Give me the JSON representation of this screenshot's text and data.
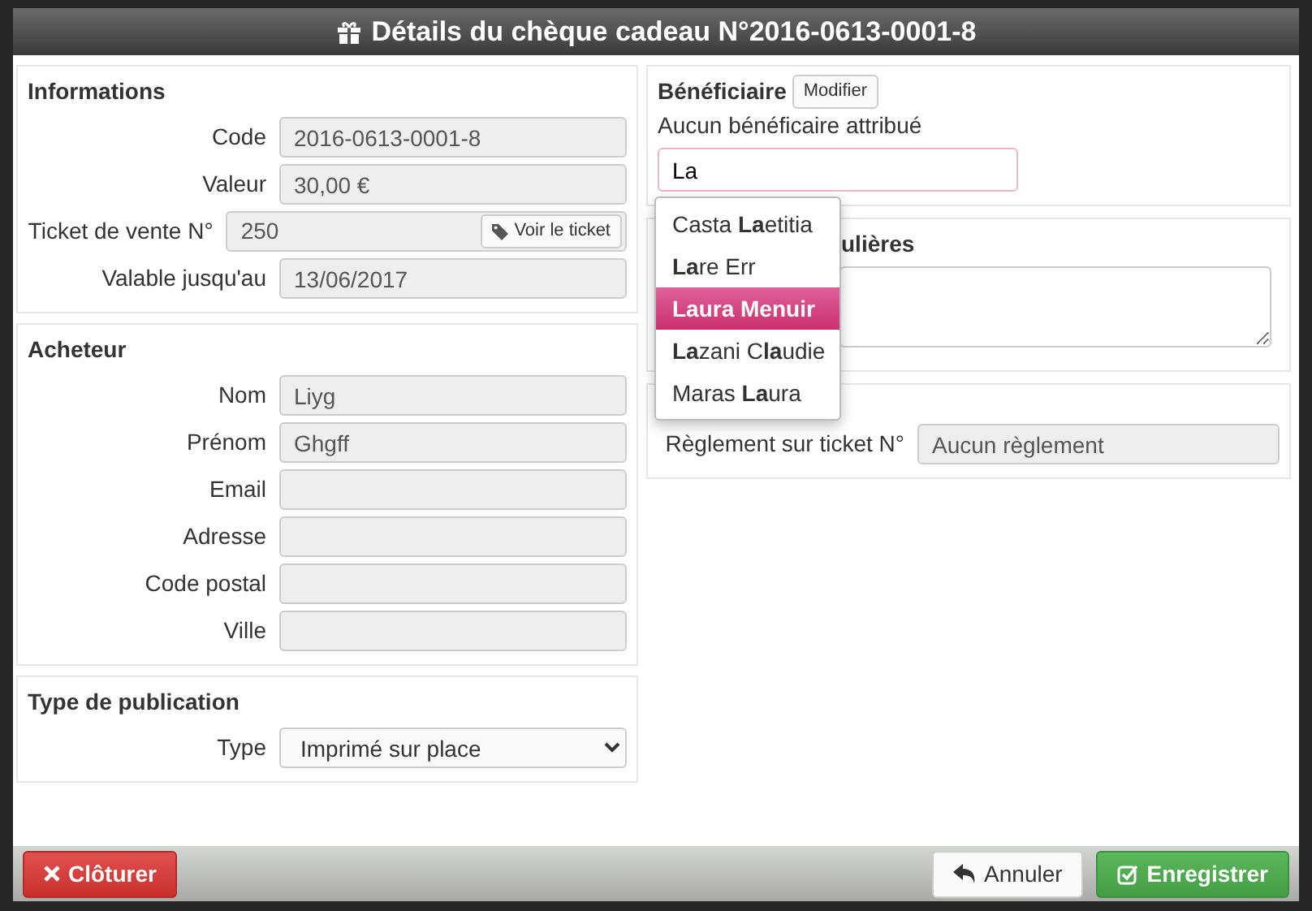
{
  "window": {
    "title": "Détails du chèque cadeau N°2016-0613-0001-8"
  },
  "informations": {
    "heading": "Informations",
    "fields": [
      {
        "label": "Code",
        "value": "2016-0613-0001-8",
        "kind": "text"
      },
      {
        "label": "Valeur",
        "value": "30,00 €",
        "kind": "text"
      },
      {
        "label": "Ticket de vente N°",
        "value": "250",
        "kind": "text",
        "button": "Voir le ticket"
      },
      {
        "label": "Valable jusqu'au",
        "value": "13/06/2017",
        "kind": "text"
      }
    ]
  },
  "acheteur": {
    "heading": "Acheteur",
    "fields": [
      {
        "label": "Nom",
        "value": "Liyg",
        "kind": "text"
      },
      {
        "label": "Prénom",
        "value": "Ghgff",
        "kind": "text"
      },
      {
        "label": "Email",
        "kind": "text"
      },
      {
        "label": "Adresse",
        "kind": "text"
      },
      {
        "label": "Code postal",
        "kind": "text"
      },
      {
        "label": "Ville",
        "kind": "text"
      }
    ]
  },
  "publication": {
    "heading": "Type de publication",
    "fields": [
      {
        "label": "Type",
        "value": "Imprimé sur place",
        "kind": "select"
      }
    ]
  },
  "beneficiaire": {
    "heading": "Bénéficiaire",
    "button": "Modifier",
    "status": "Aucun bénéficaire attribué",
    "search_value": "La"
  },
  "suggestions": [
    {
      "text": "Casta **La**etitia",
      "selected": false
    },
    {
      "text": "**La**re Err",
      "selected": false
    },
    {
      "text": "Laura Menuir",
      "selected": true
    },
    {
      "text": "**La**zani C**la**udie",
      "selected": false
    },
    {
      "text": "Maras **La**ura",
      "selected": false
    }
  ],
  "remarques": {
    "heading": "ulières"
  },
  "reglement": {
    "fields": [
      {
        "label": "Règlement sur ticket N°",
        "value": "Aucun règlement",
        "kind": "text"
      }
    ]
  },
  "footer": {
    "buttons": [
      {
        "label": "Clôturer",
        "kind": "close"
      },
      {
        "label": "Annuler",
        "kind": "cancel"
      },
      {
        "label": "Enregistrer",
        "kind": "save"
      }
    ]
  }
}
